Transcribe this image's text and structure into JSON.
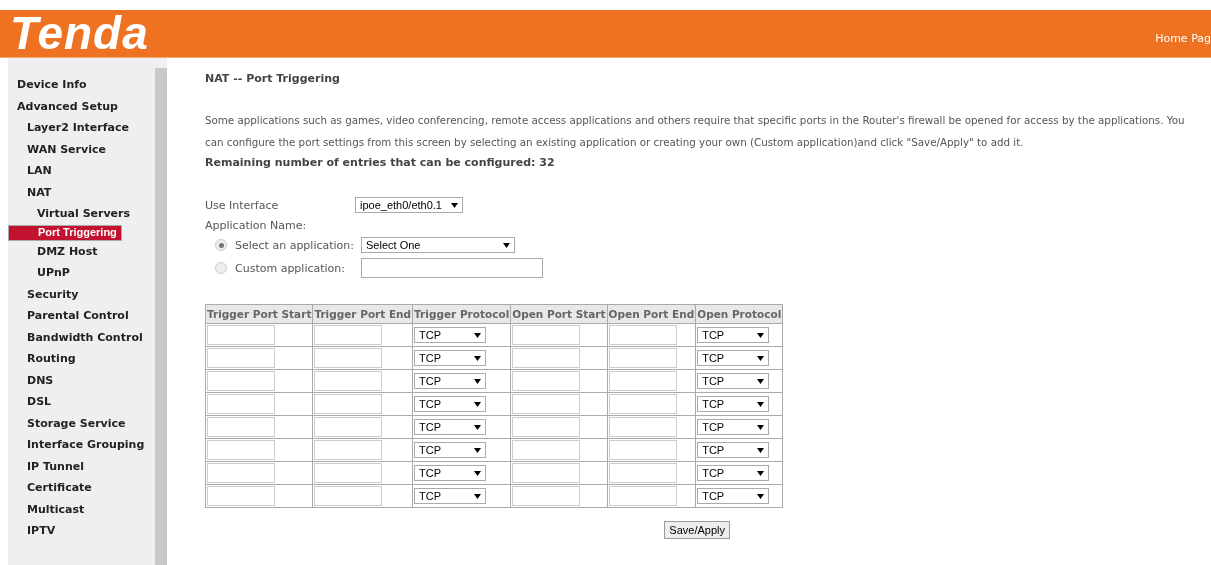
{
  "header": {
    "logo": "Tenda",
    "link": "Home Pag"
  },
  "sidebar": {
    "items": [
      {
        "label": "Device Info",
        "selected": false
      },
      {
        "label": "Advanced Setup",
        "selected": false,
        "children": [
          {
            "label": "Layer2 Interface",
            "selected": false
          },
          {
            "label": "WAN Service",
            "selected": false
          },
          {
            "label": "LAN",
            "selected": false
          },
          {
            "label": "NAT",
            "selected": false,
            "children": [
              {
                "label": "Virtual Servers",
                "selected": false
              },
              {
                "label": "Port Triggering",
                "selected": true
              },
              {
                "label": "DMZ Host",
                "selected": false
              },
              {
                "label": "UPnP",
                "selected": false
              }
            ]
          },
          {
            "label": "Security",
            "selected": false
          },
          {
            "label": "Parental Control",
            "selected": false
          },
          {
            "label": "Bandwidth Control",
            "selected": false
          },
          {
            "label": "Routing",
            "selected": false
          },
          {
            "label": "DNS",
            "selected": false
          },
          {
            "label": "DSL",
            "selected": false
          },
          {
            "label": "Storage Service",
            "selected": false
          },
          {
            "label": "Interface Grouping",
            "selected": false
          },
          {
            "label": "IP Tunnel",
            "selected": false
          },
          {
            "label": "Certificate",
            "selected": false
          },
          {
            "label": "Multicast",
            "selected": false
          },
          {
            "label": "IPTV",
            "selected": false
          }
        ]
      }
    ]
  },
  "page_title": "NAT -- Port Triggering",
  "description": "Some applications such as games, video conferencing, remote access applications and others require that specific ports in the Router's firewall be opened for access by the applications. You can configure the port settings from this screen by selecting an existing application or creating your own (Custom application)and click \"Save/Apply\" to add it.",
  "remaining": "Remaining number of entries that can be configured: 32",
  "use_interface": {
    "label": "Use Interface",
    "value": "ipoe_eth0/eth0.1"
  },
  "application_name": {
    "label": "Application Name:",
    "options": [
      {
        "label": "Select an application:",
        "selected": true,
        "kind": "select",
        "value": "Select One"
      },
      {
        "label": "Custom application:",
        "selected": false,
        "kind": "input"
      }
    ]
  },
  "table": {
    "columns": [
      "Trigger Port Start",
      "Trigger Port End",
      "Trigger Protocol",
      "Open Port Start",
      "Open Port End",
      "Open Protocol"
    ],
    "rows": [
      {
        "trigger_protocol": "TCP",
        "open_protocol": "TCP"
      },
      {
        "trigger_protocol": "TCP",
        "open_protocol": "TCP"
      },
      {
        "trigger_protocol": "TCP",
        "open_protocol": "TCP"
      },
      {
        "trigger_protocol": "TCP",
        "open_protocol": "TCP"
      },
      {
        "trigger_protocol": "TCP",
        "open_protocol": "TCP"
      },
      {
        "trigger_protocol": "TCP",
        "open_protocol": "TCP"
      },
      {
        "trigger_protocol": "TCP",
        "open_protocol": "TCP"
      },
      {
        "trigger_protocol": "TCP",
        "open_protocol": "TCP"
      }
    ]
  },
  "save_button": "Save/Apply"
}
